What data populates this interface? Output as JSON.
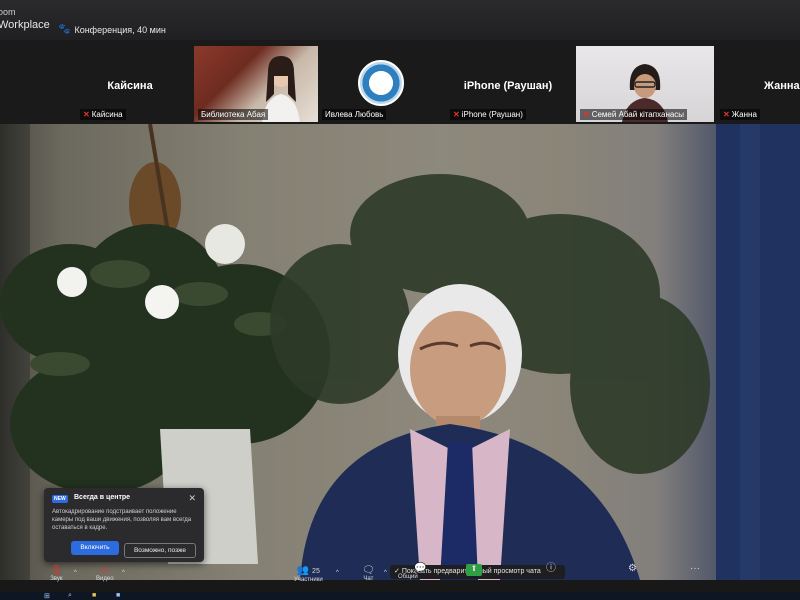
{
  "title_bar": {
    "app_line1": "oom",
    "app_line2": "Workplace",
    "meeting_label": "Конференция, 40 мин"
  },
  "participants": [
    {
      "big_name": "Кайсина",
      "caption": "Кайсина",
      "muted": true
    },
    {
      "big_name": "",
      "caption": "Библиотека Абая",
      "muted": false
    },
    {
      "big_name": "",
      "caption": "Ивлева Любовь",
      "muted": false
    },
    {
      "big_name": "iPhone (Раушан)",
      "caption": "iPhone (Раушан)",
      "muted": true
    },
    {
      "big_name": "",
      "caption": "Семей Абай кітапханасы",
      "muted": true
    },
    {
      "big_name": "Жанна",
      "caption": "Жанна",
      "muted": true
    }
  ],
  "popup": {
    "badge": "NEW",
    "title": "Всегда в центре",
    "body": "Автокадрирование подстраивает положение камеры под ваши движения, позволяя вам всегда оставаться в кадре.",
    "primary_button": "Включить",
    "secondary_button": "Возможно, позже"
  },
  "chat_preview": {
    "label": "Показать предварительный просмотр чата",
    "checked": true
  },
  "toolbar": {
    "audio": "Звук",
    "video": "Видео",
    "participants": "Участники",
    "participants_count": "25",
    "chat": "Чат",
    "share": "Общий"
  },
  "colors": {
    "accent": "#2d6cdf",
    "muted_red": "#e5322d"
  }
}
